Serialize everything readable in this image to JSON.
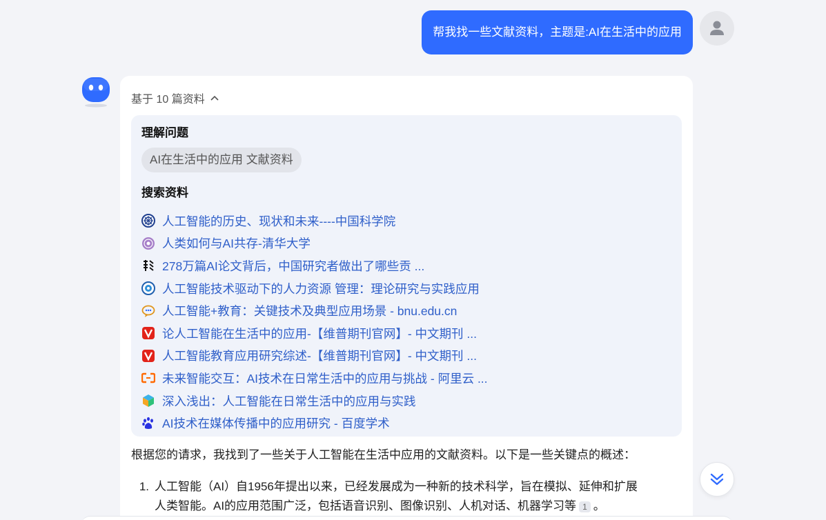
{
  "user_message": "帮我找一些文献资料，主题是:AI在生活中的应用",
  "sources_toggle": "基于 10 篇资料",
  "understand": {
    "title": "理解问题",
    "query": "AI在生活中的应用 文献资料"
  },
  "search": {
    "title": "搜索资料",
    "items": [
      {
        "icon": "cas-icon",
        "label": "人工智能的历史、现状和未来----中国科学院"
      },
      {
        "icon": "tsinghua-icon",
        "label": "人类如何与AI共存-清华大学"
      },
      {
        "icon": "thepaper-icon",
        "label": "278万篇AI论文背后，中国研究者做出了哪些贡 ..."
      },
      {
        "icon": "university-icon",
        "label": "人工智能技术驱动下的人力资源 管理：理论研究与实践应用"
      },
      {
        "icon": "bnu-icon",
        "label": "人工智能+教育：关键技术及典型应用场景 - bnu.edu.cn"
      },
      {
        "icon": "cqvip-icon",
        "label": "论人工智能在生活中的应用-【维普期刊官网】- 中文期刊 ..."
      },
      {
        "icon": "cqvip-icon",
        "label": "人工智能教育应用研究综述-【维普期刊官网】- 中文期刊 ..."
      },
      {
        "icon": "aliyun-icon",
        "label": "未来智能交互：AI技术在日常生活中的应用与挑战 - 阿里云 ..."
      },
      {
        "icon": "cube-icon",
        "label": "深入浅出：人工智能在日常生活中的应用与实践"
      },
      {
        "icon": "baidu-icon",
        "label": "AI技术在媒体传播中的应用研究 - 百度学术"
      }
    ]
  },
  "answer": {
    "intro": "根据您的请求，我找到了一些关于人工智能在生活中应用的文献资料。以下是一些关键点的概述：",
    "points": [
      {
        "num": "1.",
        "line1": "人工智能（AI）自1956年提出以来，已经发展成为一种新的技术科学，旨在模拟、延伸和扩展",
        "line2": "人类智能。AI的应用范围广泛，包括语音识别、图像识别、人机对话、机器学习等",
        "cite": "1",
        "end": "。"
      }
    ]
  },
  "colors": {
    "accent": "#2f6bff",
    "link": "#2f5fc9",
    "panel": "#f0f3fa",
    "background": "#f3f4f8"
  }
}
